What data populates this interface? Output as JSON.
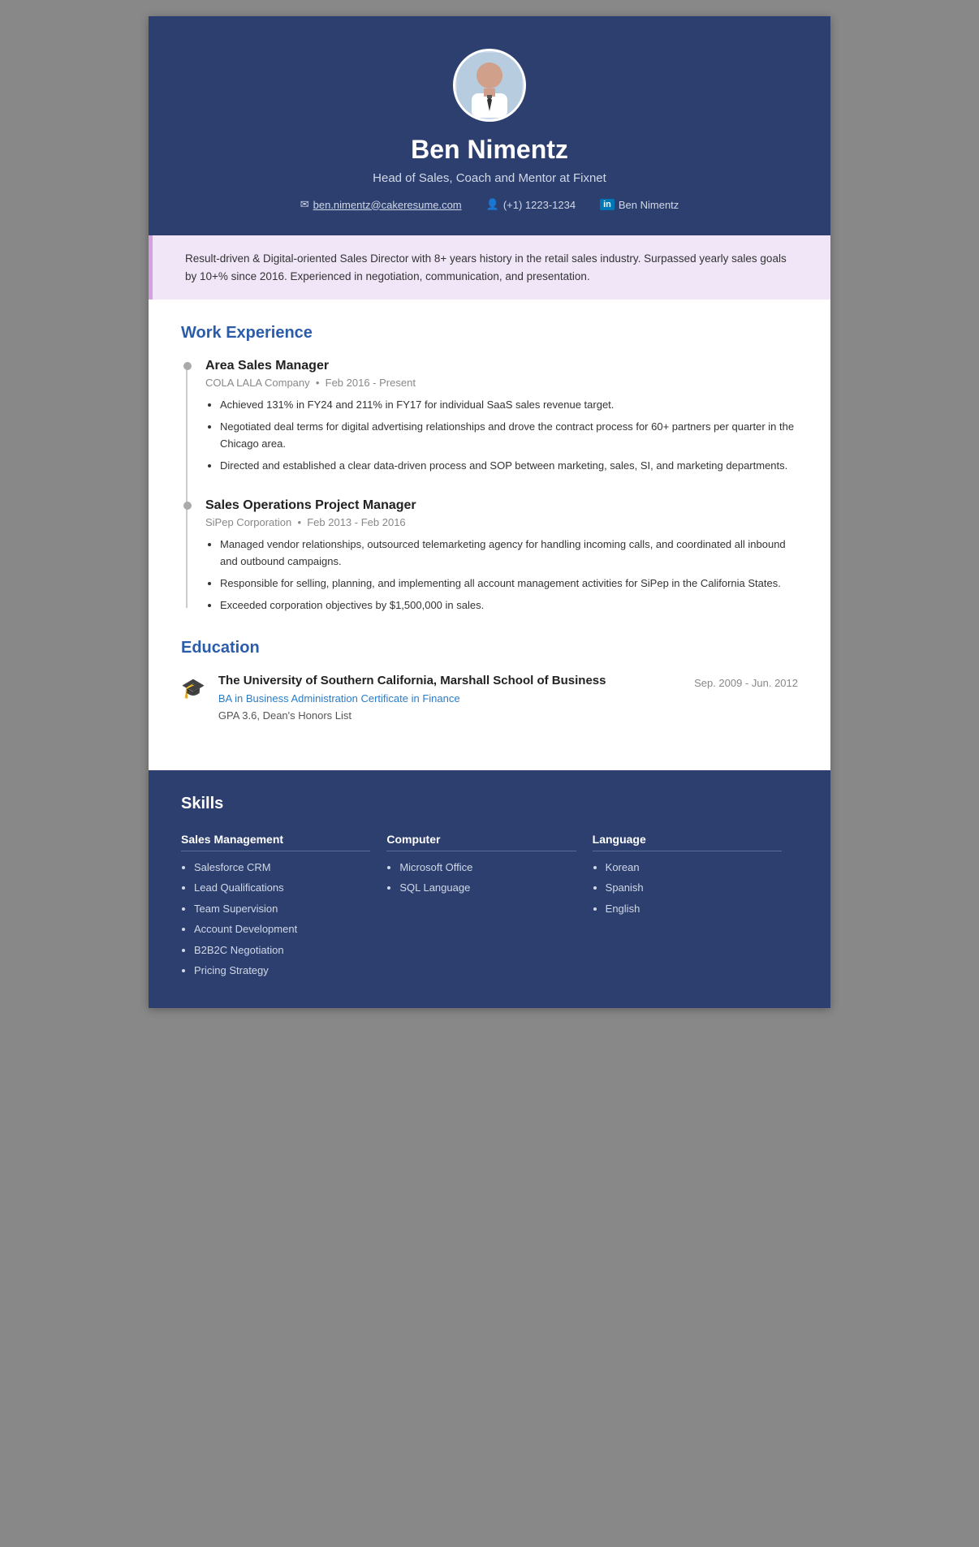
{
  "header": {
    "name": "Ben Nimentz",
    "title": "Head of Sales, Coach and Mentor at Fixnet",
    "email": "ben.nimentz@cakeresume.com",
    "phone": "(+1) 1223-1234",
    "linkedin": "Ben Nimentz"
  },
  "summary": {
    "text": "Result-driven & Digital-oriented Sales Director with 8+ years history in the retail sales industry. Surpassed yearly sales goals by 10+% since 2016. Experienced in negotiation, communication, and presentation."
  },
  "work_experience": {
    "section_title": "Work Experience",
    "jobs": [
      {
        "role": "Area Sales Manager",
        "company": "COLA LALA Company",
        "dates": "Feb 2016 - Present",
        "bullets": [
          "Achieved 131% in FY24 and 211% in FY17 for individual SaaS sales revenue target.",
          "Negotiated deal terms for digital advertising relationships and drove the contract process for 60+ partners per quarter in the Chicago area.",
          "Directed and established a clear data-driven process and SOP between marketing, sales, SI, and marketing departments."
        ]
      },
      {
        "role": "Sales Operations Project Manager",
        "company": "SiPep Corporation",
        "dates": "Feb 2013 - Feb 2016",
        "bullets": [
          "Managed vendor relationships, outsourced telemarketing agency for handling incoming calls, and coordinated all inbound and outbound campaigns.",
          "Responsible for selling, planning, and implementing all account management activities for SiPep in the California States.",
          "Exceeded corporation objectives by $1,500,000 in sales."
        ]
      }
    ]
  },
  "education": {
    "section_title": "Education",
    "items": [
      {
        "school": "The University of Southern California, Marshall School of Business",
        "dates": "Sep. 2009 - Jun. 2012",
        "degree": "BA in Business Administration Certificate in Finance",
        "gpa": "GPA 3.6, Dean's Honors List"
      }
    ]
  },
  "skills": {
    "section_title": "Skills",
    "columns": [
      {
        "title": "Sales Management",
        "items": [
          "Salesforce CRM",
          "Lead Qualifications",
          "Team Supervision",
          "Account Development",
          "B2B2C Negotiation",
          "Pricing Strategy"
        ]
      },
      {
        "title": "Computer",
        "items": [
          "Microsoft Office",
          "SQL Language"
        ]
      },
      {
        "title": "Language",
        "items": [
          "Korean",
          "Spanish",
          "English"
        ]
      }
    ]
  }
}
